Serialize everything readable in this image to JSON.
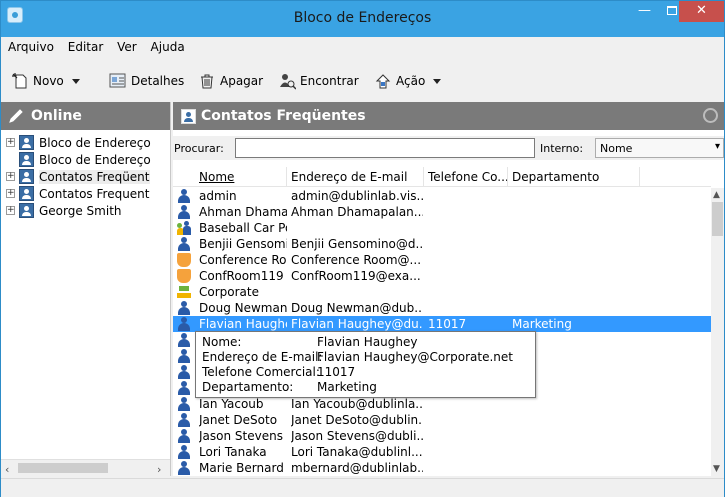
{
  "window": {
    "title": "Bloco de Endereços"
  },
  "menu": [
    "Arquivo",
    "Editar",
    "Ver",
    "Ajuda"
  ],
  "toolbar": {
    "new": "Novo",
    "details": "Detalhes",
    "delete": "Apagar",
    "find": "Encontrar",
    "action": "Ação"
  },
  "left": {
    "header": "Online",
    "tree": [
      "Bloco de Endereço",
      "Bloco de Endereço",
      "Contatos Freqüent",
      "Contatos Frequent",
      "George Smith"
    ]
  },
  "right": {
    "header": "Contatos Freqüentes",
    "search_label": "Procurar:",
    "search_value": "",
    "internal_label": "Interno:",
    "internal_value": "Nome",
    "columns": [
      "Nome",
      "Endereço de E-mail",
      "Telefone Co...",
      "Departamento"
    ],
    "rows": [
      {
        "icon": "person",
        "name": "admin",
        "email": "admin@dublinlab.vis...",
        "phone": "",
        "dept": ""
      },
      {
        "icon": "person",
        "name": "Ahman Dhama...",
        "email": "Ahman Dhamapalan...",
        "phone": "",
        "dept": ""
      },
      {
        "icon": "group",
        "name": "Baseball Car Pool",
        "email": "",
        "phone": "",
        "dept": ""
      },
      {
        "icon": "person",
        "name": "Benjii Gensomi...",
        "email": "Benjii Gensomino@d...",
        "phone": "",
        "dept": ""
      },
      {
        "icon": "room",
        "name": "Conference Ro...",
        "email": "Conference Room@...",
        "phone": "",
        "dept": ""
      },
      {
        "icon": "room",
        "name": "ConfRoom119",
        "email": "ConfRoom119@exa...",
        "phone": "",
        "dept": ""
      },
      {
        "icon": "corp",
        "name": "Corporate",
        "email": "",
        "phone": "",
        "dept": ""
      },
      {
        "icon": "person",
        "name": "Doug Newman",
        "email": "Doug Newman@dub...",
        "phone": "",
        "dept": ""
      },
      {
        "icon": "person",
        "name": "Flavian Haughey",
        "email": "Flavian Haughey@du...",
        "phone": "11017",
        "dept": "Marketing",
        "selected": true
      },
      {
        "icon": "person",
        "name": "",
        "email": "",
        "phone": "",
        "dept": ""
      },
      {
        "icon": "person",
        "name": "",
        "email": "",
        "phone": "",
        "dept": ""
      },
      {
        "icon": "person",
        "name": "",
        "email": "",
        "phone": "",
        "dept": ""
      },
      {
        "icon": "person",
        "name": "",
        "email": "",
        "phone": "",
        "dept": ""
      },
      {
        "icon": "person",
        "name": "Ian Yacoub",
        "email": "Ian Yacoub@dublinla...",
        "phone": "",
        "dept": ""
      },
      {
        "icon": "person",
        "name": "Janet DeSoto",
        "email": "Janet DeSoto@dublin...",
        "phone": "",
        "dept": ""
      },
      {
        "icon": "person",
        "name": "Jason Stevens",
        "email": "Jason Stevens@dubli...",
        "phone": "",
        "dept": ""
      },
      {
        "icon": "person",
        "name": "Lori Tanaka",
        "email": "Lori Tanaka@dublinl...",
        "phone": "",
        "dept": ""
      },
      {
        "icon": "person",
        "name": "Marie Bernard",
        "email": "mbernard@dublinlab...",
        "phone": "",
        "dept": ""
      }
    ]
  },
  "tooltip": {
    "labels": [
      "Nome:",
      "Endereço de E-mail:",
      "Telefone Comercial:",
      "Departamento:"
    ],
    "values": [
      "Flavian Haughey",
      "Flavian Haughey@Corporate.net",
      "11017",
      "Marketing"
    ]
  }
}
